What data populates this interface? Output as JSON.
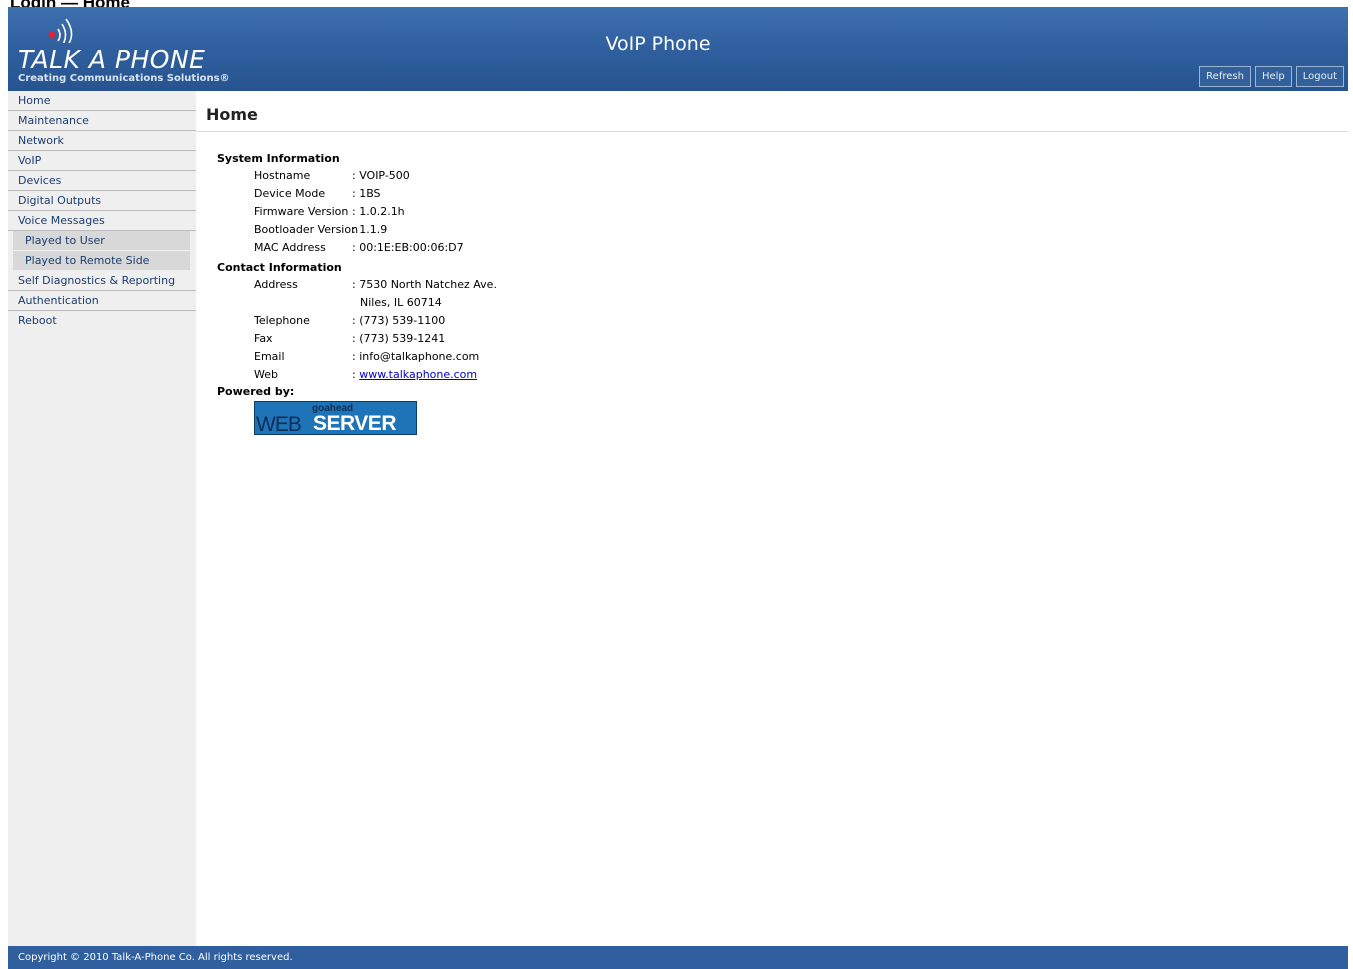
{
  "caption": "Login — Home",
  "header": {
    "logo_text": "TALK A PHONE",
    "logo_tagline": "Creating Communications Solutions®",
    "app_title": "VoIP Phone",
    "buttons": {
      "refresh": "Refresh",
      "help": "Help",
      "logout": "Logout"
    }
  },
  "sidebar": {
    "items": [
      {
        "label": "Home"
      },
      {
        "label": "Maintenance"
      },
      {
        "label": "Network"
      },
      {
        "label": "VoIP"
      },
      {
        "label": "Devices"
      },
      {
        "label": "Digital Outputs"
      },
      {
        "label": "Voice Messages"
      },
      {
        "label": "Played to User"
      },
      {
        "label": "Played to Remote Side"
      },
      {
        "label": "Self Diagnostics & Reporting"
      },
      {
        "label": "Authentication"
      },
      {
        "label": "Reboot"
      }
    ]
  },
  "main": {
    "title": "Home",
    "system_info": {
      "heading": "System Information",
      "hostname": {
        "label": "Hostname",
        "value": ": VOIP-500"
      },
      "device_mode": {
        "label": "Device Mode",
        "value": ": 1BS"
      },
      "firmware": {
        "label": "Firmware Version",
        "value": ": 1.0.2.1h"
      },
      "bootloader": {
        "label": "Bootloader Version",
        "value": ": 1.1.9"
      },
      "mac": {
        "label": "MAC Address",
        "value": ": 00:1E:EB:00:06:D7"
      }
    },
    "contact_info": {
      "heading": "Contact Information",
      "address": {
        "label": "Address",
        "value": ": 7530 North Natchez Ave.",
        "value2": "Niles, IL 60714"
      },
      "telephone": {
        "label": "Telephone",
        "value": ": (773) 539-1100"
      },
      "fax": {
        "label": "Fax",
        "value": ": (773) 539-1241"
      },
      "email": {
        "label": "Email",
        "value": ": info@talkaphone.com"
      },
      "web": {
        "label": "Web",
        "prefix": ": ",
        "link": "www.talkaphone.com"
      }
    },
    "powered_by": {
      "heading": "Powered by:",
      "badge": {
        "top": "goahead",
        "web": "WEB",
        "server": "SERVER"
      }
    }
  },
  "footer": {
    "copyright": "Copyright © 2010 Talk-A-Phone Co. All rights reserved."
  },
  "colors": {
    "header_blue": "#2f5f9f",
    "sidebar_bg": "#efefef",
    "submenu_bg": "#d8d8d8",
    "nav_text": "#1c3c70",
    "link": "#0000cc"
  }
}
